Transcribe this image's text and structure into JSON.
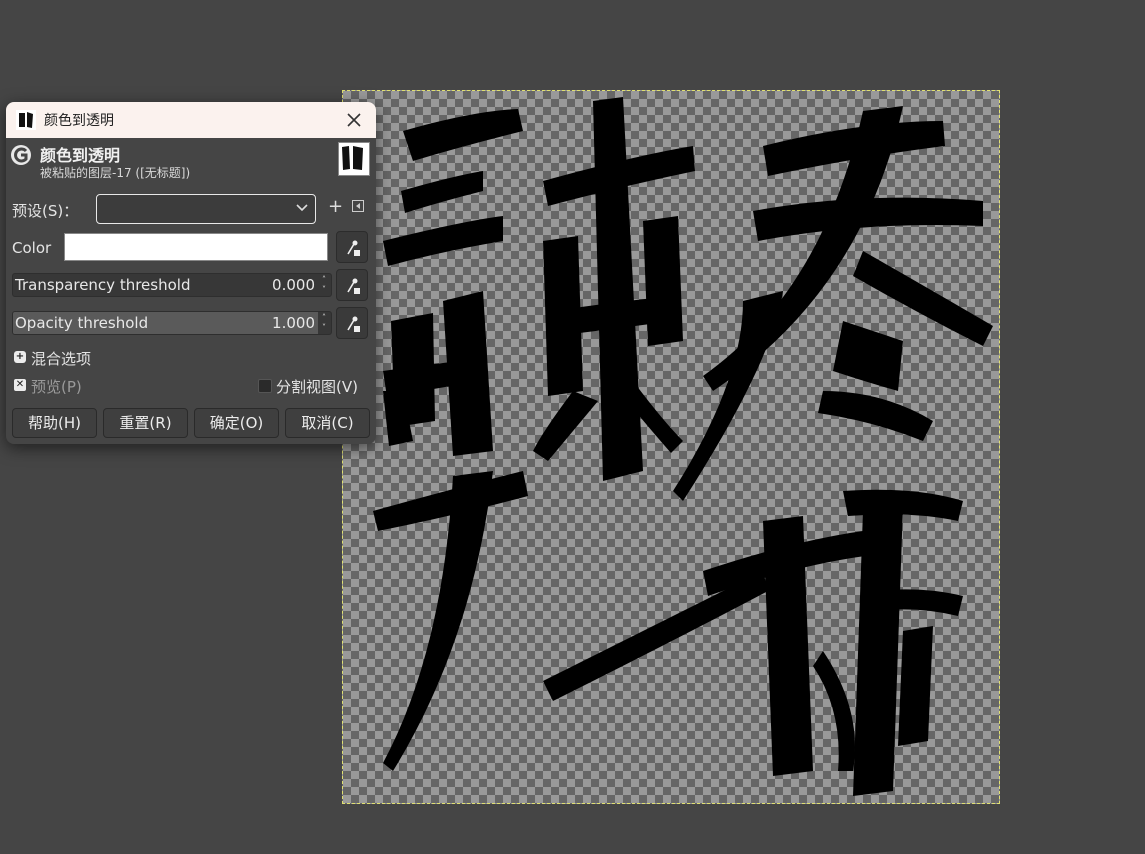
{
  "window": {
    "title": "颜色到透明"
  },
  "header": {
    "title": "颜色到透明",
    "subtitle": "被粘贴的图层-17 ([无标题])"
  },
  "preset": {
    "label": "预设(S)：",
    "value": ""
  },
  "color": {
    "label": "Color",
    "swatch": "#ffffff"
  },
  "transparency": {
    "label": "Transparency threshold",
    "value": "0.000"
  },
  "opacity": {
    "label": "Opacity threshold",
    "value": "1.000"
  },
  "blending": {
    "label": "混合选项"
  },
  "preview": {
    "label": "预览(P)",
    "checked": true
  },
  "split_view": {
    "label": "分割视图(V)",
    "checked": false
  },
  "buttons": {
    "help": "帮助(H)",
    "reset": "重置(R)",
    "ok": "确定(O)",
    "cancel": "取消(C)"
  },
  "icons": {
    "app": "gimp-logo-icon",
    "close": "close-icon",
    "color_picker": "eyedropper-icon",
    "add_preset": "plus-icon",
    "preset_menu": "menu-icon"
  }
}
